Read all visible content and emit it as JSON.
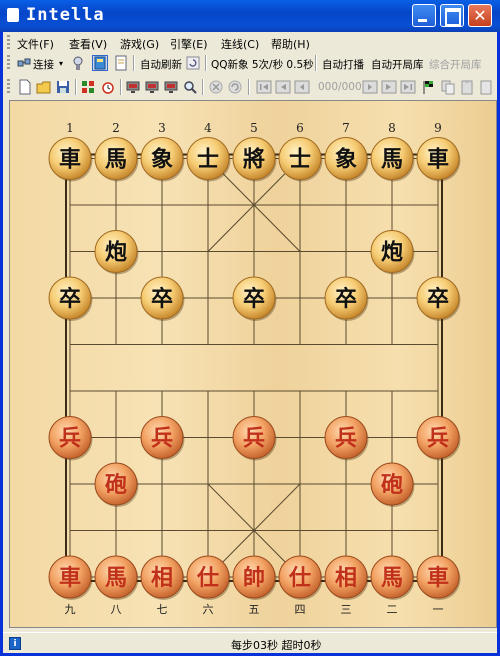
{
  "window": {
    "title": "Intella",
    "close_glyph": "✕"
  },
  "menu": [
    {
      "label": "文件(F)"
    },
    {
      "label": "查看(V)"
    },
    {
      "label": "游戏(G)"
    },
    {
      "label": "引擎(E)"
    },
    {
      "label": "连线(C)"
    },
    {
      "label": "帮助(H)"
    }
  ],
  "toolbar1": {
    "connect": "连接",
    "auto_refresh": "自动刷新",
    "qq_speed": "QQ新象 5次/秒 0.5秒",
    "auto_play": "自动打播",
    "auto_book": "自动开局库",
    "combined_book": "综合开局库"
  },
  "toolbar2": {
    "move_counter": "000/000"
  },
  "board": {
    "top_file_labels": [
      "1",
      "2",
      "3",
      "4",
      "5",
      "6",
      "7",
      "8",
      "9"
    ],
    "bottom_file_labels": [
      "九",
      "八",
      "七",
      "六",
      "五",
      "四",
      "三",
      "二",
      "一"
    ],
    "pieces": [
      {
        "char": "車",
        "side": "black",
        "file": 0,
        "rank": 0
      },
      {
        "char": "馬",
        "side": "black",
        "file": 1,
        "rank": 0
      },
      {
        "char": "象",
        "side": "black",
        "file": 2,
        "rank": 0
      },
      {
        "char": "士",
        "side": "black",
        "file": 3,
        "rank": 0
      },
      {
        "char": "將",
        "side": "black",
        "file": 4,
        "rank": 0
      },
      {
        "char": "士",
        "side": "black",
        "file": 5,
        "rank": 0
      },
      {
        "char": "象",
        "side": "black",
        "file": 6,
        "rank": 0
      },
      {
        "char": "馬",
        "side": "black",
        "file": 7,
        "rank": 0
      },
      {
        "char": "車",
        "side": "black",
        "file": 8,
        "rank": 0
      },
      {
        "char": "炮",
        "side": "black",
        "file": 1,
        "rank": 2
      },
      {
        "char": "炮",
        "side": "black",
        "file": 7,
        "rank": 2
      },
      {
        "char": "卒",
        "side": "black",
        "file": 0,
        "rank": 3
      },
      {
        "char": "卒",
        "side": "black",
        "file": 2,
        "rank": 3
      },
      {
        "char": "卒",
        "side": "black",
        "file": 4,
        "rank": 3
      },
      {
        "char": "卒",
        "side": "black",
        "file": 6,
        "rank": 3
      },
      {
        "char": "卒",
        "side": "black",
        "file": 8,
        "rank": 3
      },
      {
        "char": "兵",
        "side": "red",
        "file": 0,
        "rank": 6
      },
      {
        "char": "兵",
        "side": "red",
        "file": 2,
        "rank": 6
      },
      {
        "char": "兵",
        "side": "red",
        "file": 4,
        "rank": 6
      },
      {
        "char": "兵",
        "side": "red",
        "file": 6,
        "rank": 6
      },
      {
        "char": "兵",
        "side": "red",
        "file": 8,
        "rank": 6
      },
      {
        "char": "砲",
        "side": "red",
        "file": 1,
        "rank": 7
      },
      {
        "char": "砲",
        "side": "red",
        "file": 7,
        "rank": 7
      },
      {
        "char": "車",
        "side": "red",
        "file": 0,
        "rank": 9
      },
      {
        "char": "馬",
        "side": "red",
        "file": 1,
        "rank": 9
      },
      {
        "char": "相",
        "side": "red",
        "file": 2,
        "rank": 9
      },
      {
        "char": "仕",
        "side": "red",
        "file": 3,
        "rank": 9
      },
      {
        "char": "帥",
        "side": "red",
        "file": 4,
        "rank": 9
      },
      {
        "char": "仕",
        "side": "red",
        "file": 5,
        "rank": 9
      },
      {
        "char": "相",
        "side": "red",
        "file": 6,
        "rank": 9
      },
      {
        "char": "馬",
        "side": "red",
        "file": 7,
        "rank": 9
      },
      {
        "char": "車",
        "side": "red",
        "file": 8,
        "rank": 9
      }
    ]
  },
  "status": {
    "text": "每步03秒  超时0秒"
  },
  "colors": {
    "black_piece_text": "#111111",
    "red_piece_text": "#c0301a",
    "title_blue": "#0a5fe6"
  }
}
